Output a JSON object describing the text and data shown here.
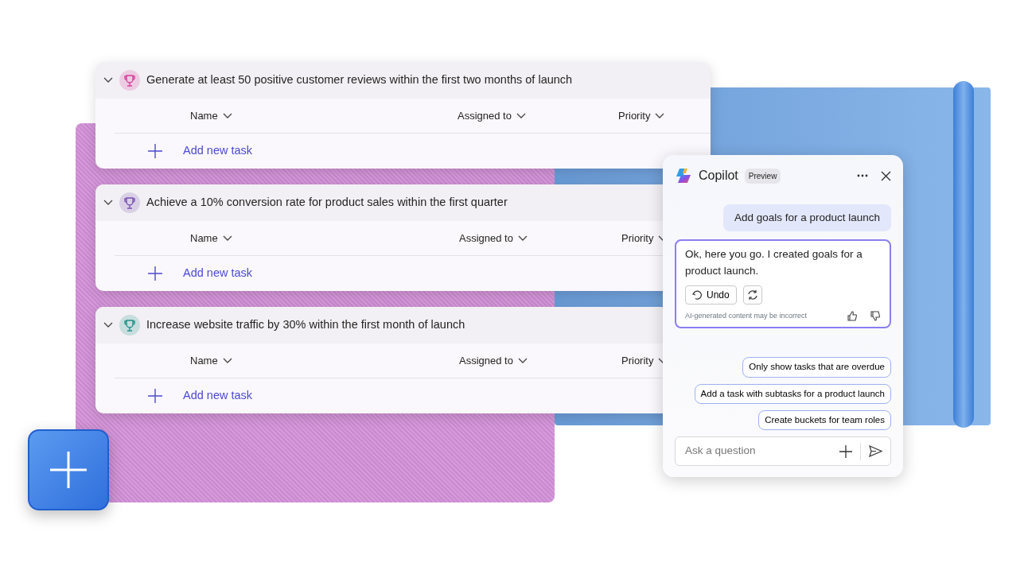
{
  "goals": [
    {
      "title": "Generate at least 50 positive customer reviews within the first two months of launch",
      "color": "#d63c9a",
      "expanded": true,
      "columns": [
        "Name",
        "Assigned to",
        "Priority"
      ],
      "add_task": "Add new task"
    },
    {
      "title": "Achieve a 10% conversion rate for product sales within the first quarter",
      "color": "#7a4fb0",
      "expanded": true,
      "columns": [
        "Name",
        "Assigned to",
        "Priority"
      ],
      "add_task": "Add new task"
    },
    {
      "title": "Increase website traffic by 30% within the first month of launch",
      "color": "#1f8f86",
      "expanded": true,
      "columns": [
        "Name",
        "Assigned to",
        "Priority"
      ],
      "add_task": "Add new task"
    }
  ],
  "copilot": {
    "title": "Copilot",
    "badge": "Preview",
    "user_message": "Add goals for a product launch",
    "reply": {
      "text": "Ok, here you go. I created goals for a product launch.",
      "undo": "Undo",
      "disclaimer": "AI-generated content may be incorrect"
    },
    "suggestions": [
      "Only show tasks that are overdue",
      "Add a task with subtasks for a product launch",
      "Create buckets for team roles"
    ],
    "input": {
      "placeholder": "Ask a question"
    }
  }
}
